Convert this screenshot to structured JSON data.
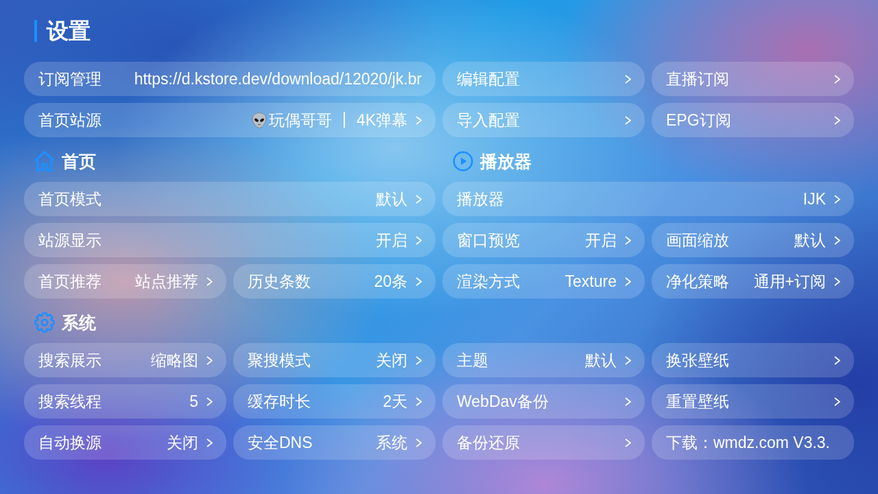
{
  "title": "设置",
  "top_items": [
    {
      "label": "订阅管理",
      "value": "https://d.kstore.dev/download/12020/jk.br",
      "arrow": false,
      "wide": true
    },
    {
      "label": "编辑配置",
      "arrow": true,
      "wide": false
    },
    {
      "label": "直播订阅",
      "arrow": true,
      "wide": false
    },
    {
      "label": "首页站源",
      "value": "玩偶哥哥 ┃ 4K弹幕",
      "value_icon": true,
      "arrow": true,
      "wide": true
    },
    {
      "label": "导入配置",
      "arrow": true,
      "wide": false
    },
    {
      "label": "EPG订阅",
      "arrow": true,
      "wide": false
    }
  ],
  "section_rows": [
    [
      {
        "kind": "home",
        "title": "首页",
        "items": [
          {
            "label": "首页模式",
            "value": "默认",
            "arrow": true,
            "wide": true
          },
          {
            "label": "站源显示",
            "value": "开启",
            "arrow": true,
            "wide": true
          },
          {
            "label": "首页推荐",
            "value": "站点推荐",
            "arrow": true,
            "wide": false
          },
          {
            "label": "历史条数",
            "value": "20条",
            "arrow": true,
            "wide": false
          }
        ]
      },
      {
        "kind": "player",
        "title": "播放器",
        "items": [
          {
            "label": "播放器",
            "value": "IJK",
            "arrow": true,
            "wide": true
          },
          {
            "label": "窗口预览",
            "value": "开启",
            "arrow": true,
            "wide": false
          },
          {
            "label": "画面缩放",
            "value": "默认",
            "arrow": true,
            "wide": false
          },
          {
            "label": "渲染方式",
            "value": "Texture",
            "arrow": true,
            "wide": false
          },
          {
            "label": "净化策略",
            "value": "通用+订阅",
            "arrow": true,
            "wide": false
          }
        ]
      }
    ],
    [
      {
        "kind": "system",
        "title": "系统",
        "items": [
          {
            "label": "搜索展示",
            "value": "缩略图",
            "arrow": true,
            "wide": false
          },
          {
            "label": "聚搜模式",
            "value": "关闭",
            "arrow": true,
            "wide": false
          },
          {
            "label": "主题",
            "value": "默认",
            "arrow": true,
            "wide": false
          },
          {
            "label": "换张壁纸",
            "arrow": true,
            "wide": false
          },
          {
            "label": "搜索线程",
            "value": "5",
            "arrow": true,
            "wide": false
          },
          {
            "label": "缓存时长",
            "value": "2天",
            "arrow": true,
            "wide": false
          },
          {
            "label": "WebDav备份",
            "arrow": true,
            "wide": false
          },
          {
            "label": "重置壁纸",
            "arrow": true,
            "wide": false
          },
          {
            "label": "自动换源",
            "value": "关闭",
            "arrow": true,
            "wide": false
          },
          {
            "label": "安全DNS",
            "value": "系统",
            "arrow": true,
            "wide": false
          },
          {
            "label": "备份还原",
            "arrow": true,
            "wide": false
          },
          {
            "label": "下载：wmdz.com V3.3.",
            "arrow": false,
            "wide": false
          }
        ]
      }
    ]
  ]
}
